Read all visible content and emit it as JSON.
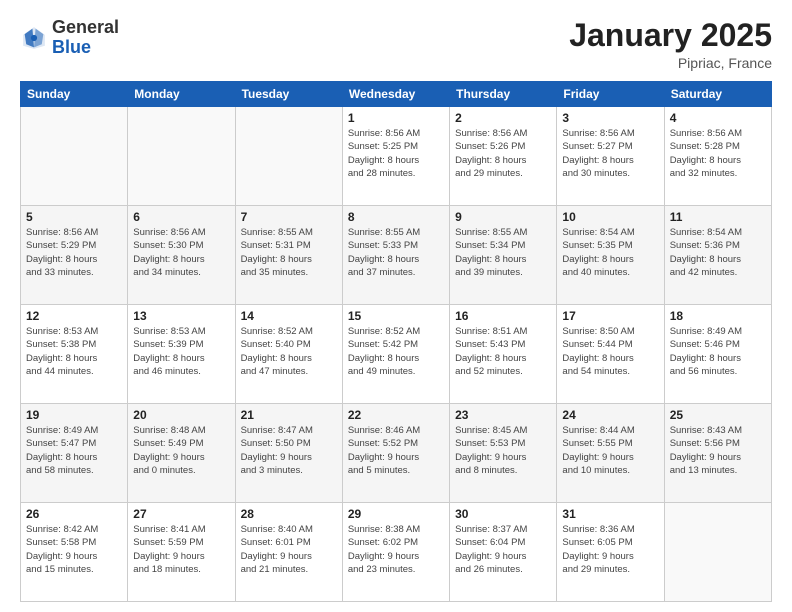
{
  "logo": {
    "general": "General",
    "blue": "Blue"
  },
  "header": {
    "month": "January 2025",
    "location": "Pipriac, France"
  },
  "weekdays": [
    "Sunday",
    "Monday",
    "Tuesday",
    "Wednesday",
    "Thursday",
    "Friday",
    "Saturday"
  ],
  "weeks": [
    [
      {
        "day": "",
        "info": ""
      },
      {
        "day": "",
        "info": ""
      },
      {
        "day": "",
        "info": ""
      },
      {
        "day": "1",
        "info": "Sunrise: 8:56 AM\nSunset: 5:25 PM\nDaylight: 8 hours\nand 28 minutes."
      },
      {
        "day": "2",
        "info": "Sunrise: 8:56 AM\nSunset: 5:26 PM\nDaylight: 8 hours\nand 29 minutes."
      },
      {
        "day": "3",
        "info": "Sunrise: 8:56 AM\nSunset: 5:27 PM\nDaylight: 8 hours\nand 30 minutes."
      },
      {
        "day": "4",
        "info": "Sunrise: 8:56 AM\nSunset: 5:28 PM\nDaylight: 8 hours\nand 32 minutes."
      }
    ],
    [
      {
        "day": "5",
        "info": "Sunrise: 8:56 AM\nSunset: 5:29 PM\nDaylight: 8 hours\nand 33 minutes."
      },
      {
        "day": "6",
        "info": "Sunrise: 8:56 AM\nSunset: 5:30 PM\nDaylight: 8 hours\nand 34 minutes."
      },
      {
        "day": "7",
        "info": "Sunrise: 8:55 AM\nSunset: 5:31 PM\nDaylight: 8 hours\nand 35 minutes."
      },
      {
        "day": "8",
        "info": "Sunrise: 8:55 AM\nSunset: 5:33 PM\nDaylight: 8 hours\nand 37 minutes."
      },
      {
        "day": "9",
        "info": "Sunrise: 8:55 AM\nSunset: 5:34 PM\nDaylight: 8 hours\nand 39 minutes."
      },
      {
        "day": "10",
        "info": "Sunrise: 8:54 AM\nSunset: 5:35 PM\nDaylight: 8 hours\nand 40 minutes."
      },
      {
        "day": "11",
        "info": "Sunrise: 8:54 AM\nSunset: 5:36 PM\nDaylight: 8 hours\nand 42 minutes."
      }
    ],
    [
      {
        "day": "12",
        "info": "Sunrise: 8:53 AM\nSunset: 5:38 PM\nDaylight: 8 hours\nand 44 minutes."
      },
      {
        "day": "13",
        "info": "Sunrise: 8:53 AM\nSunset: 5:39 PM\nDaylight: 8 hours\nand 46 minutes."
      },
      {
        "day": "14",
        "info": "Sunrise: 8:52 AM\nSunset: 5:40 PM\nDaylight: 8 hours\nand 47 minutes."
      },
      {
        "day": "15",
        "info": "Sunrise: 8:52 AM\nSunset: 5:42 PM\nDaylight: 8 hours\nand 49 minutes."
      },
      {
        "day": "16",
        "info": "Sunrise: 8:51 AM\nSunset: 5:43 PM\nDaylight: 8 hours\nand 52 minutes."
      },
      {
        "day": "17",
        "info": "Sunrise: 8:50 AM\nSunset: 5:44 PM\nDaylight: 8 hours\nand 54 minutes."
      },
      {
        "day": "18",
        "info": "Sunrise: 8:49 AM\nSunset: 5:46 PM\nDaylight: 8 hours\nand 56 minutes."
      }
    ],
    [
      {
        "day": "19",
        "info": "Sunrise: 8:49 AM\nSunset: 5:47 PM\nDaylight: 8 hours\nand 58 minutes."
      },
      {
        "day": "20",
        "info": "Sunrise: 8:48 AM\nSunset: 5:49 PM\nDaylight: 9 hours\nand 0 minutes."
      },
      {
        "day": "21",
        "info": "Sunrise: 8:47 AM\nSunset: 5:50 PM\nDaylight: 9 hours\nand 3 minutes."
      },
      {
        "day": "22",
        "info": "Sunrise: 8:46 AM\nSunset: 5:52 PM\nDaylight: 9 hours\nand 5 minutes."
      },
      {
        "day": "23",
        "info": "Sunrise: 8:45 AM\nSunset: 5:53 PM\nDaylight: 9 hours\nand 8 minutes."
      },
      {
        "day": "24",
        "info": "Sunrise: 8:44 AM\nSunset: 5:55 PM\nDaylight: 9 hours\nand 10 minutes."
      },
      {
        "day": "25",
        "info": "Sunrise: 8:43 AM\nSunset: 5:56 PM\nDaylight: 9 hours\nand 13 minutes."
      }
    ],
    [
      {
        "day": "26",
        "info": "Sunrise: 8:42 AM\nSunset: 5:58 PM\nDaylight: 9 hours\nand 15 minutes."
      },
      {
        "day": "27",
        "info": "Sunrise: 8:41 AM\nSunset: 5:59 PM\nDaylight: 9 hours\nand 18 minutes."
      },
      {
        "day": "28",
        "info": "Sunrise: 8:40 AM\nSunset: 6:01 PM\nDaylight: 9 hours\nand 21 minutes."
      },
      {
        "day": "29",
        "info": "Sunrise: 8:38 AM\nSunset: 6:02 PM\nDaylight: 9 hours\nand 23 minutes."
      },
      {
        "day": "30",
        "info": "Sunrise: 8:37 AM\nSunset: 6:04 PM\nDaylight: 9 hours\nand 26 minutes."
      },
      {
        "day": "31",
        "info": "Sunrise: 8:36 AM\nSunset: 6:05 PM\nDaylight: 9 hours\nand 29 minutes."
      },
      {
        "day": "",
        "info": ""
      }
    ]
  ]
}
